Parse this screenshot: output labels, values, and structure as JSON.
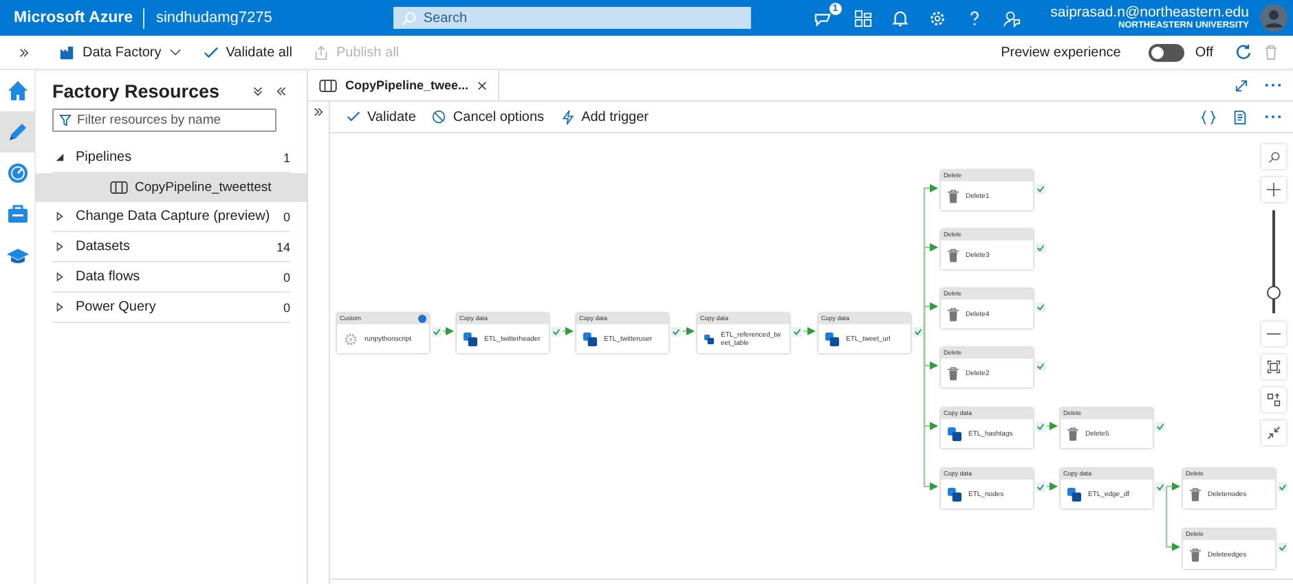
{
  "top_bar": {
    "brand": "Microsoft Azure",
    "directory": "sindhudamg7275",
    "search": {
      "placeholder": "Search"
    },
    "notification_count": "1",
    "user": {
      "email": "saiprasad.n@northeastern.edu",
      "organization": "NORTHEASTERN UNIVERSITY"
    }
  },
  "toolbar": {
    "factory": "Data Factory",
    "actions": [
      {
        "kind": "validate",
        "label": "Validate all",
        "disabled": false
      },
      {
        "kind": "publish",
        "label": "Publish all",
        "disabled": true
      }
    ],
    "preview": {
      "label": "Preview experience",
      "on": false,
      "state": "Off"
    }
  },
  "nav": [
    {
      "kind": "home",
      "selected": false
    },
    {
      "kind": "author",
      "selected": true
    },
    {
      "kind": "monitor",
      "selected": false
    },
    {
      "kind": "manage",
      "selected": false
    },
    {
      "kind": "learn",
      "selected": false
    }
  ],
  "resources": {
    "title": "Factory Resources",
    "filter": {
      "placeholder": "Filter resources by name"
    },
    "items": [
      {
        "label": "Pipelines",
        "count": "1",
        "expanded": true,
        "children": [
          {
            "label": "CopyPipeline_tweettest",
            "selected": true
          }
        ]
      },
      {
        "label": "Change Data Capture (preview)",
        "count": "0",
        "expanded": false
      },
      {
        "label": "Datasets",
        "count": "14",
        "expanded": false
      },
      {
        "label": "Data flows",
        "count": "0",
        "expanded": false
      },
      {
        "label": "Power Query",
        "count": "0",
        "expanded": false
      }
    ]
  },
  "editor": {
    "tab": {
      "label": "CopyPipeline_twee..."
    },
    "commands": [
      {
        "kind": "validate",
        "label": "Validate"
      },
      {
        "kind": "cancel",
        "label": "Cancel options"
      },
      {
        "kind": "trigger",
        "label": "Add trigger"
      }
    ],
    "canvas": {
      "activities": [
        {
          "kind": "custom",
          "type": "Custom",
          "name": "runpythonscript"
        },
        {
          "kind": "copy",
          "type": "Copy data",
          "name": "ETL_twitterheader"
        },
        {
          "kind": "copy",
          "type": "Copy data",
          "name": "ETL_twitteruser"
        },
        {
          "kind": "copy",
          "type": "Copy data",
          "name": "ETL_referenced_tweet_table"
        },
        {
          "kind": "copy",
          "type": "Copy data",
          "name": "ETL_tweet_url"
        },
        {
          "kind": "delete",
          "type": "Delete",
          "name": "Delete1"
        },
        {
          "kind": "delete",
          "type": "Delete",
          "name": "Delete3"
        },
        {
          "kind": "delete",
          "type": "Delete",
          "name": "Delete4"
        },
        {
          "kind": "delete",
          "type": "Delete",
          "name": "Delete2"
        },
        {
          "kind": "copy",
          "type": "Copy data",
          "name": "ETL_hashtags"
        },
        {
          "kind": "delete",
          "type": "Delete",
          "name": "Delete5"
        },
        {
          "kind": "copy",
          "type": "Copy data",
          "name": "ETL_nodes"
        },
        {
          "kind": "copy",
          "type": "Copy data",
          "name": "ETL_edge_df"
        },
        {
          "kind": "delete",
          "type": "Delete",
          "name": "Deletenodes"
        },
        {
          "kind": "delete",
          "type": "Delete",
          "name": "Deleteedges"
        }
      ],
      "zoom": {
        "level": 0.2
      }
    }
  }
}
